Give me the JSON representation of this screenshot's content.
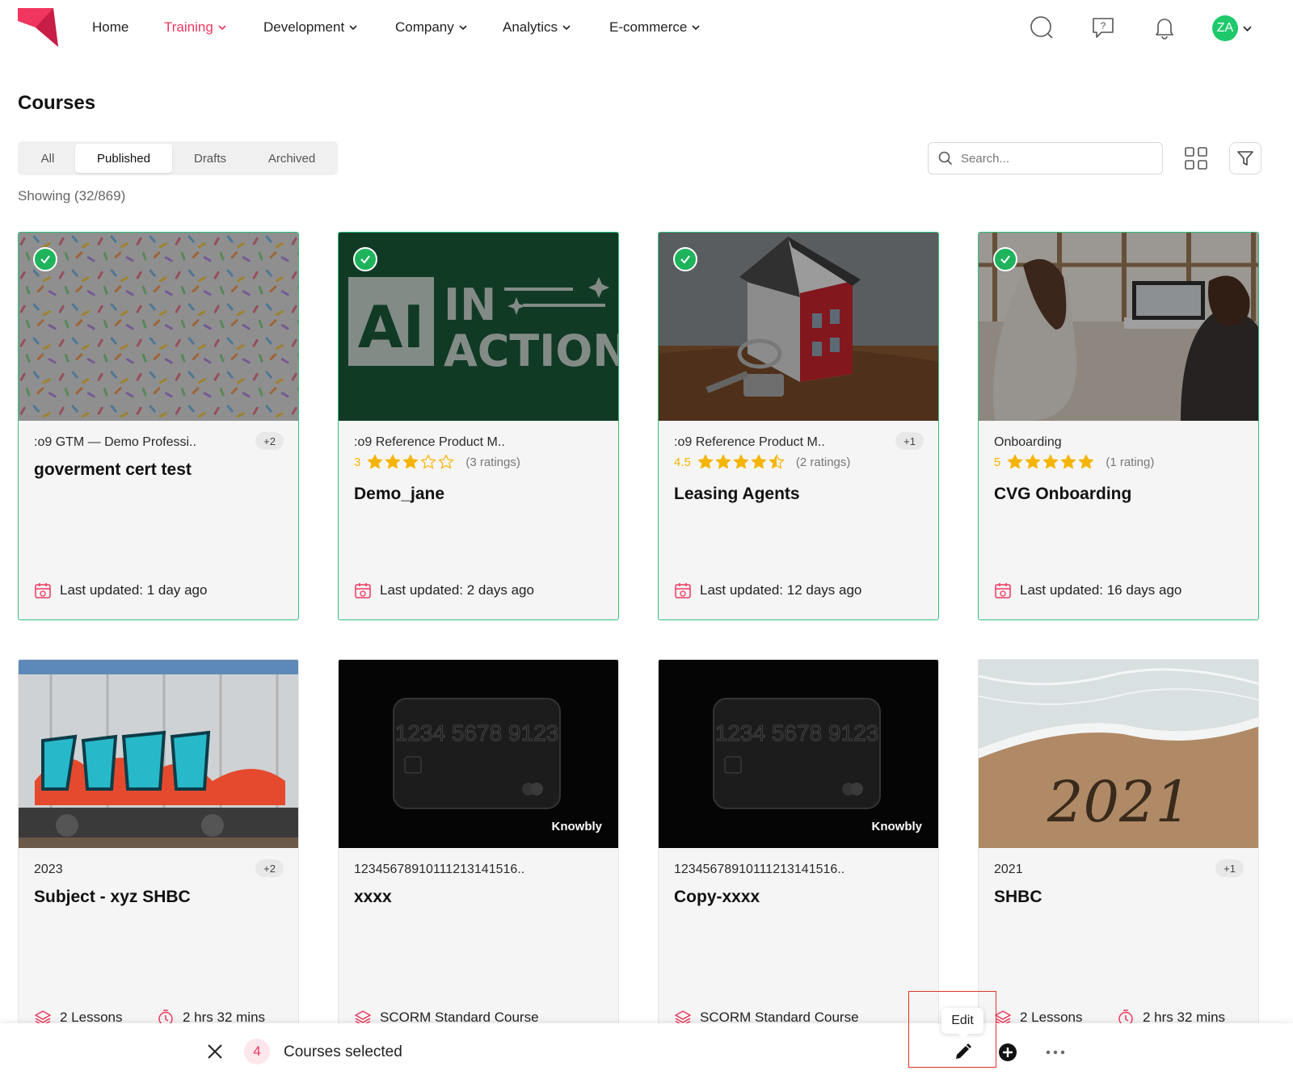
{
  "nav": {
    "items": [
      {
        "label": "Home",
        "dropdown": false
      },
      {
        "label": "Training",
        "dropdown": true,
        "active": true
      },
      {
        "label": "Development",
        "dropdown": true
      },
      {
        "label": "Company",
        "dropdown": true
      },
      {
        "label": "Analytics",
        "dropdown": true
      },
      {
        "label": "E-commerce",
        "dropdown": true
      }
    ],
    "icons": [
      "search-icon",
      "help-chat-icon",
      "bell-icon"
    ],
    "avatar_initials": "ZA",
    "brand_color": "#f0365e",
    "avatar_color": "#1ec96b"
  },
  "page": {
    "title": "Courses",
    "tabs": [
      "All",
      "Published",
      "Drafts",
      "Archived"
    ],
    "selected_tab": "Published",
    "search_placeholder": "Search...",
    "showing": "Showing (32/869)"
  },
  "cards": [
    {
      "subtitle": ":o9 GTM — Demo Professi..",
      "badge": "+2",
      "title": "goverment cert test",
      "updated": "Last updated: 1 day ago",
      "selected": true,
      "image": "sprinkles"
    },
    {
      "subtitle": ":o9 Reference Product M..",
      "rating": {
        "value": "3",
        "stars": 3,
        "count": "(3 ratings)"
      },
      "title": "Demo_jane",
      "updated": "Last updated: 2 days ago",
      "selected": true,
      "image": "ai-in-action",
      "image_text": [
        "AI",
        "IN",
        "ACTION"
      ]
    },
    {
      "subtitle": ":o9 Reference Product M..",
      "badge": "+1",
      "rating": {
        "value": "4.5",
        "stars": 4.5,
        "count": "(2 ratings)"
      },
      "title": "Leasing Agents",
      "updated": "Last updated: 12 days ago",
      "selected": true,
      "image": "house-keys"
    },
    {
      "subtitle": "Onboarding",
      "rating": {
        "value": "5",
        "stars": 5,
        "count": "(1 rating)"
      },
      "title": "CVG Onboarding",
      "updated": "Last updated: 16 days ago",
      "selected": true,
      "image": "office-meeting"
    },
    {
      "subtitle": "2023",
      "badge": "+2",
      "title": "Subject - xyz SHBC",
      "lessons": "2 Lessons",
      "duration": "2 hrs 32 mins",
      "image": "graffiti-train"
    },
    {
      "subtitle": "12345678910111213141516..",
      "title": "xxxx",
      "scorm": "SCORM Standard Course",
      "image": "credit-card",
      "image_text": [
        "1234 5678 9123",
        "Knowbly"
      ]
    },
    {
      "subtitle": "12345678910111213141516..",
      "title": "Copy-xxxx",
      "scorm": "SCORM Standard Course",
      "image": "credit-card",
      "image_text": [
        "1234 5678 9123",
        "Knowbly"
      ]
    },
    {
      "subtitle": "2021",
      "badge": "+1",
      "title": "SHBC",
      "lessons": "2 Lessons",
      "duration": "2 hrs 32 mins",
      "image": "beach-2021",
      "image_text": [
        "2021"
      ]
    }
  ],
  "bottom_bar": {
    "count": "4",
    "label": "Courses selected",
    "tooltip": "Edit",
    "actions": [
      "close-icon",
      "edit-icon",
      "add-icon",
      "more-icon"
    ]
  }
}
